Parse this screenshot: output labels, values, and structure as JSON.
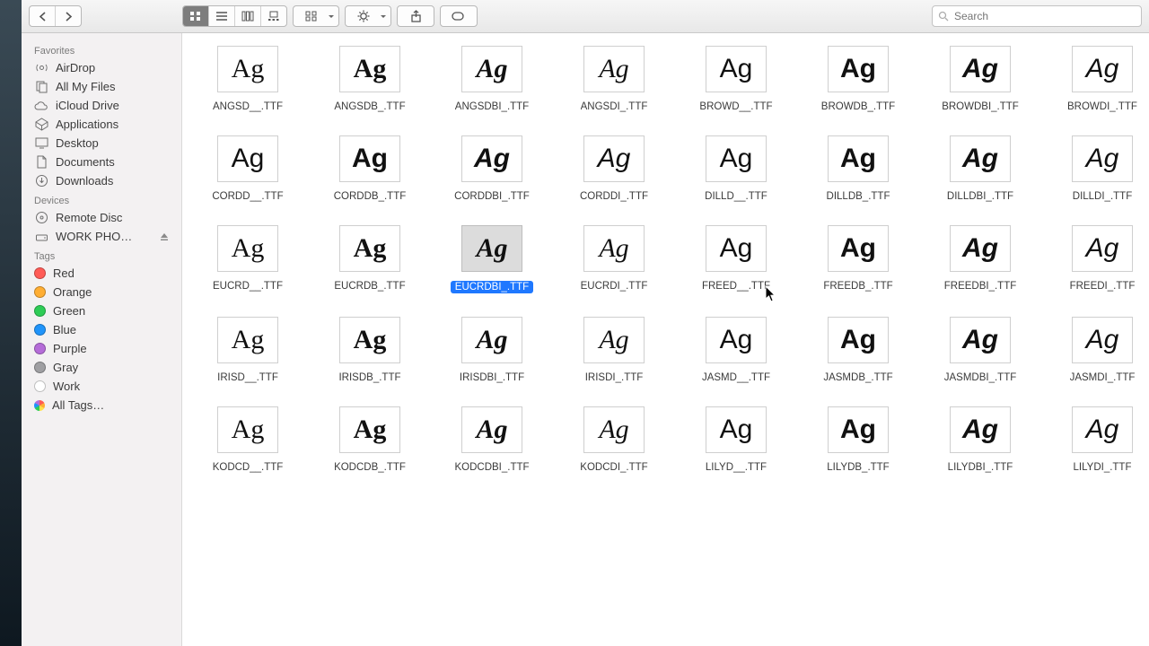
{
  "search": {
    "placeholder": "Search"
  },
  "sidebar": {
    "sections": {
      "favorites": "Favorites",
      "devices": "Devices",
      "tags": "Tags"
    },
    "favorites": [
      {
        "icon": "airdrop",
        "label": "AirDrop"
      },
      {
        "icon": "files",
        "label": "All My Files"
      },
      {
        "icon": "cloud",
        "label": "iCloud Drive"
      },
      {
        "icon": "apps",
        "label": "Applications"
      },
      {
        "icon": "desktop",
        "label": "Desktop"
      },
      {
        "icon": "docs",
        "label": "Documents"
      },
      {
        "icon": "download",
        "label": "Downloads"
      }
    ],
    "devices": [
      {
        "icon": "disc",
        "label": "Remote Disc"
      },
      {
        "icon": "drive",
        "label": "WORK PHO…",
        "eject": true
      }
    ],
    "tags": [
      {
        "color": "red",
        "label": "Red"
      },
      {
        "color": "orange",
        "label": "Orange"
      },
      {
        "color": "green",
        "label": "Green"
      },
      {
        "color": "blue",
        "label": "Blue"
      },
      {
        "color": "purple",
        "label": "Purple"
      },
      {
        "color": "gray",
        "label": "Gray"
      },
      {
        "color": "none",
        "label": "Work"
      },
      {
        "color": "all",
        "label": "All Tags…"
      }
    ]
  },
  "files": [
    {
      "name": "ANGSD__.TTF",
      "sans": false,
      "bold": false,
      "ital": false
    },
    {
      "name": "ANGSDB_.TTF",
      "sans": false,
      "bold": true,
      "ital": false
    },
    {
      "name": "ANGSDBI_.TTF",
      "sans": false,
      "bold": true,
      "ital": true
    },
    {
      "name": "ANGSDI_.TTF",
      "sans": false,
      "bold": false,
      "ital": true
    },
    {
      "name": "BROWD__.TTF",
      "sans": true,
      "bold": false,
      "ital": false
    },
    {
      "name": "BROWDB_.TTF",
      "sans": true,
      "bold": true,
      "ital": false
    },
    {
      "name": "BROWDBI_.TTF",
      "sans": true,
      "bold": true,
      "ital": true
    },
    {
      "name": "BROWDI_.TTF",
      "sans": true,
      "bold": false,
      "ital": true
    },
    {
      "name": "CORDD__.TTF",
      "sans": true,
      "bold": false,
      "ital": false
    },
    {
      "name": "CORDDB_.TTF",
      "sans": true,
      "bold": true,
      "ital": false
    },
    {
      "name": "CORDDBI_.TTF",
      "sans": true,
      "bold": true,
      "ital": true
    },
    {
      "name": "CORDDI_.TTF",
      "sans": true,
      "bold": false,
      "ital": true
    },
    {
      "name": "DILLD__.TTF",
      "sans": true,
      "bold": false,
      "ital": false
    },
    {
      "name": "DILLDB_.TTF",
      "sans": true,
      "bold": true,
      "ital": false
    },
    {
      "name": "DILLDBI_.TTF",
      "sans": true,
      "bold": true,
      "ital": true
    },
    {
      "name": "DILLDI_.TTF",
      "sans": true,
      "bold": false,
      "ital": true
    },
    {
      "name": "EUCRD__.TTF",
      "sans": false,
      "bold": false,
      "ital": false
    },
    {
      "name": "EUCRDB_.TTF",
      "sans": false,
      "bold": true,
      "ital": false
    },
    {
      "name": "EUCRDBI_.TTF",
      "sans": false,
      "bold": true,
      "ital": true,
      "selected": true
    },
    {
      "name": "EUCRDI_.TTF",
      "sans": false,
      "bold": false,
      "ital": true
    },
    {
      "name": "FREED__.TTF",
      "sans": true,
      "bold": false,
      "ital": false
    },
    {
      "name": "FREEDB_.TTF",
      "sans": true,
      "bold": true,
      "ital": false
    },
    {
      "name": "FREEDBI_.TTF",
      "sans": true,
      "bold": true,
      "ital": true
    },
    {
      "name": "FREEDI_.TTF",
      "sans": true,
      "bold": false,
      "ital": true
    },
    {
      "name": "IRISD__.TTF",
      "sans": false,
      "bold": false,
      "ital": false
    },
    {
      "name": "IRISDB_.TTF",
      "sans": false,
      "bold": true,
      "ital": false
    },
    {
      "name": "IRISDBI_.TTF",
      "sans": false,
      "bold": true,
      "ital": true
    },
    {
      "name": "IRISDI_.TTF",
      "sans": false,
      "bold": false,
      "ital": true
    },
    {
      "name": "JASMD__.TTF",
      "sans": true,
      "bold": false,
      "ital": false
    },
    {
      "name": "JASMDB_.TTF",
      "sans": true,
      "bold": true,
      "ital": false
    },
    {
      "name": "JASMDBI_.TTF",
      "sans": true,
      "bold": true,
      "ital": true
    },
    {
      "name": "JASMDI_.TTF",
      "sans": true,
      "bold": false,
      "ital": true
    },
    {
      "name": "KODCD__.TTF",
      "sans": false,
      "bold": false,
      "ital": false
    },
    {
      "name": "KODCDB_.TTF",
      "sans": false,
      "bold": true,
      "ital": false
    },
    {
      "name": "KODCDBI_.TTF",
      "sans": false,
      "bold": true,
      "ital": true
    },
    {
      "name": "KODCDI_.TTF",
      "sans": false,
      "bold": false,
      "ital": true
    },
    {
      "name": "LILYD__.TTF",
      "sans": true,
      "bold": false,
      "ital": false
    },
    {
      "name": "LILYDB_.TTF",
      "sans": true,
      "bold": true,
      "ital": false
    },
    {
      "name": "LILYDBI_.TTF",
      "sans": true,
      "bold": true,
      "ital": true
    },
    {
      "name": "LILYDI_.TTF",
      "sans": true,
      "bold": false,
      "ital": true
    }
  ]
}
